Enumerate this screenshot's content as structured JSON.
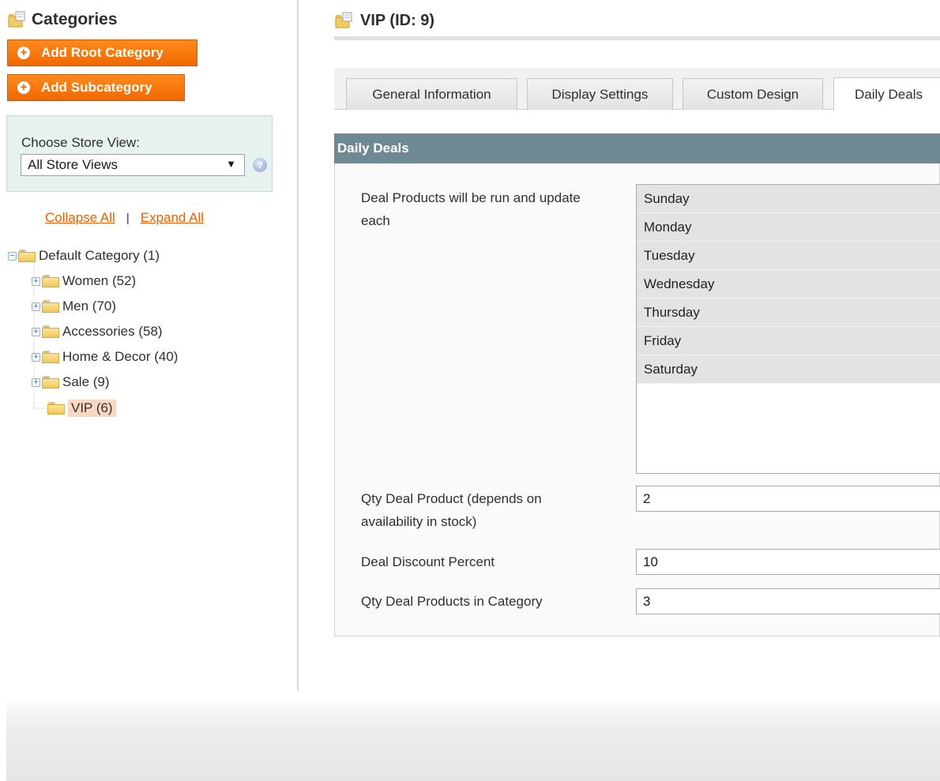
{
  "sidebar": {
    "title": "Categories",
    "add_root_label": "Add Root Category",
    "add_sub_label": "Add Subcategory",
    "store_view_label": "Choose Store View:",
    "store_view_value": "All Store Views",
    "collapse_all": "Collapse All",
    "separator": "|",
    "expand_all": "Expand All",
    "tree": [
      {
        "label": "Default Category (1)",
        "level": 0,
        "expanded": true
      },
      {
        "label": "Women (52)",
        "level": 1
      },
      {
        "label": "Men (70)",
        "level": 1
      },
      {
        "label": "Accessories (58)",
        "level": 1
      },
      {
        "label": "Home & Decor (40)",
        "level": 1
      },
      {
        "label": "Sale (9)",
        "level": 1
      },
      {
        "label": "VIP (6)",
        "level": 1,
        "selected": true
      }
    ]
  },
  "main": {
    "title": "VIP (ID: 9)",
    "tabs": [
      {
        "label": "General Information"
      },
      {
        "label": "Display Settings"
      },
      {
        "label": "Custom Design"
      },
      {
        "label": "Daily Deals",
        "active": true
      }
    ],
    "section_title": "Daily Deals",
    "fields": {
      "run_each_label": "Deal Products will be run and update each",
      "days": [
        "Sunday",
        "Monday",
        "Tuesday",
        "Wednesday",
        "Thursday",
        "Friday",
        "Saturday"
      ],
      "qty_deal_label": "Qty Deal Product (depends on availability in stock)",
      "qty_deal_value": "2",
      "discount_label": "Deal Discount Percent",
      "discount_value": "10",
      "qty_category_label": "Qty Deal Products in Category",
      "qty_category_value": "3"
    }
  },
  "colors": {
    "accent_orange": "#f06800",
    "link_orange": "#eb5e00",
    "section_header": "#6f8992",
    "store_box_bg": "#e7f1f0",
    "selected_node_bg": "#f9d7c3"
  },
  "icons": {
    "category_title": "folder-edit-icon",
    "page_title": "folder-edit-icon",
    "add": "plus-circle-icon",
    "help": "help-icon",
    "tree_toggle": "plus-box-icon",
    "tree_folder": "folder-icon"
  }
}
